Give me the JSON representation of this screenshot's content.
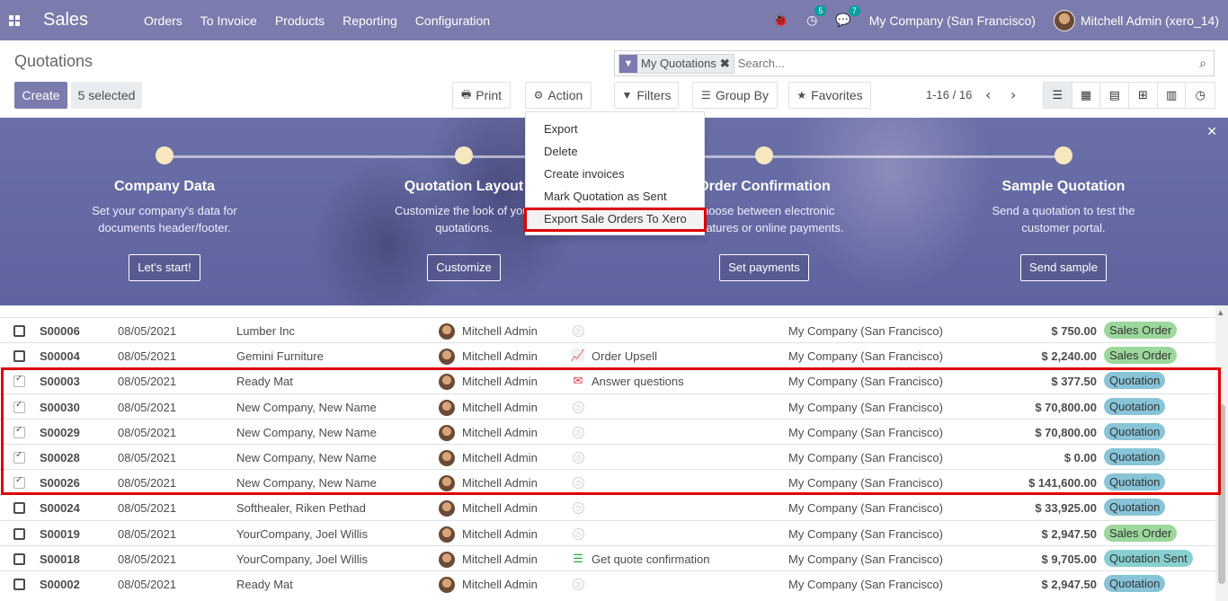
{
  "navbar": {
    "brand": "Sales",
    "menu": [
      "Orders",
      "To Invoice",
      "Products",
      "Reporting",
      "Configuration"
    ],
    "activity_count": "5",
    "message_count": "7",
    "company": "My Company (San Francisco)",
    "user": "Mitchell Admin (xero_14)"
  },
  "control": {
    "title": "Quotations",
    "create_label": "Create",
    "selected_label": "5 selected",
    "print_label": "Print",
    "action_label": "Action",
    "filters_label": "Filters",
    "groupby_label": "Group By",
    "favorites_label": "Favorites",
    "search_facet": "My Quotations",
    "search_placeholder": "Search...",
    "pager": "1-16 / 16"
  },
  "action_menu": [
    "Export",
    "Delete",
    "Create invoices",
    "Mark Quotation as Sent",
    "Export Sale Orders To Xero"
  ],
  "banner": {
    "steps": [
      {
        "title": "Company Data",
        "desc": "Set your company's data for documents header/footer.",
        "button": "Let's start!"
      },
      {
        "title": "Quotation Layout",
        "desc": "Customize the look of your quotations.",
        "button": "Customize"
      },
      {
        "title": "Order Confirmation",
        "desc": "Choose between electronic signatures or online payments.",
        "button": "Set payments"
      },
      {
        "title": "Sample Quotation",
        "desc": "Send a quotation to test the customer portal.",
        "button": "Send sample"
      }
    ]
  },
  "rows": [
    {
      "num": "S00006",
      "date": "08/05/2021",
      "customer": "Lumber Inc",
      "salesperson": "Mitchell Admin",
      "activity": "",
      "company": "My Company (San Francisco)",
      "amount": "$ 750.00",
      "status": "Sales Order",
      "checked": false
    },
    {
      "num": "S00004",
      "date": "08/05/2021",
      "customer": "Gemini Furniture",
      "salesperson": "Mitchell Admin",
      "activity": "Order Upsell",
      "company": "My Company (San Francisco)",
      "amount": "$ 2,240.00",
      "status": "Sales Order",
      "checked": false
    },
    {
      "num": "S00003",
      "date": "08/05/2021",
      "customer": "Ready Mat",
      "salesperson": "Mitchell Admin",
      "activity": "Answer questions",
      "company": "My Company (San Francisco)",
      "amount": "$ 377.50",
      "status": "Quotation",
      "checked": true
    },
    {
      "num": "S00030",
      "date": "08/05/2021",
      "customer": "New Company, New Name",
      "salesperson": "Mitchell Admin",
      "activity": "",
      "company": "My Company (San Francisco)",
      "amount": "$ 70,800.00",
      "status": "Quotation",
      "checked": true
    },
    {
      "num": "S00029",
      "date": "08/05/2021",
      "customer": "New Company, New Name",
      "salesperson": "Mitchell Admin",
      "activity": "",
      "company": "My Company (San Francisco)",
      "amount": "$ 70,800.00",
      "status": "Quotation",
      "checked": true
    },
    {
      "num": "S00028",
      "date": "08/05/2021",
      "customer": "New Company, New Name",
      "salesperson": "Mitchell Admin",
      "activity": "",
      "company": "My Company (San Francisco)",
      "amount": "$ 0.00",
      "status": "Quotation",
      "checked": true
    },
    {
      "num": "S00026",
      "date": "08/05/2021",
      "customer": "New Company, New Name",
      "salesperson": "Mitchell Admin",
      "activity": "",
      "company": "My Company (San Francisco)",
      "amount": "$ 141,600.00",
      "status": "Quotation",
      "checked": true
    },
    {
      "num": "S00024",
      "date": "08/05/2021",
      "customer": "Softhealer, Riken Pethad",
      "salesperson": "Mitchell Admin",
      "activity": "",
      "company": "My Company (San Francisco)",
      "amount": "$ 33,925.00",
      "status": "Quotation",
      "checked": false
    },
    {
      "num": "S00019",
      "date": "08/05/2021",
      "customer": "YourCompany, Joel Willis",
      "salesperson": "Mitchell Admin",
      "activity": "",
      "company": "My Company (San Francisco)",
      "amount": "$ 2,947.50",
      "status": "Sales Order",
      "checked": false
    },
    {
      "num": "S00018",
      "date": "08/05/2021",
      "customer": "YourCompany, Joel Willis",
      "salesperson": "Mitchell Admin",
      "activity": "Get quote confirmation",
      "company": "My Company (San Francisco)",
      "amount": "$ 9,705.00",
      "status": "Quotation Sent",
      "checked": false
    },
    {
      "num": "S00002",
      "date": "08/05/2021",
      "customer": "Ready Mat",
      "salesperson": "Mitchell Admin",
      "activity": "",
      "company": "My Company (San Francisco)",
      "amount": "$ 2,947.50",
      "status": "Quotation",
      "checked": false
    }
  ],
  "colors": {
    "brand": "#7c7bad",
    "highlight": "#e00000"
  }
}
